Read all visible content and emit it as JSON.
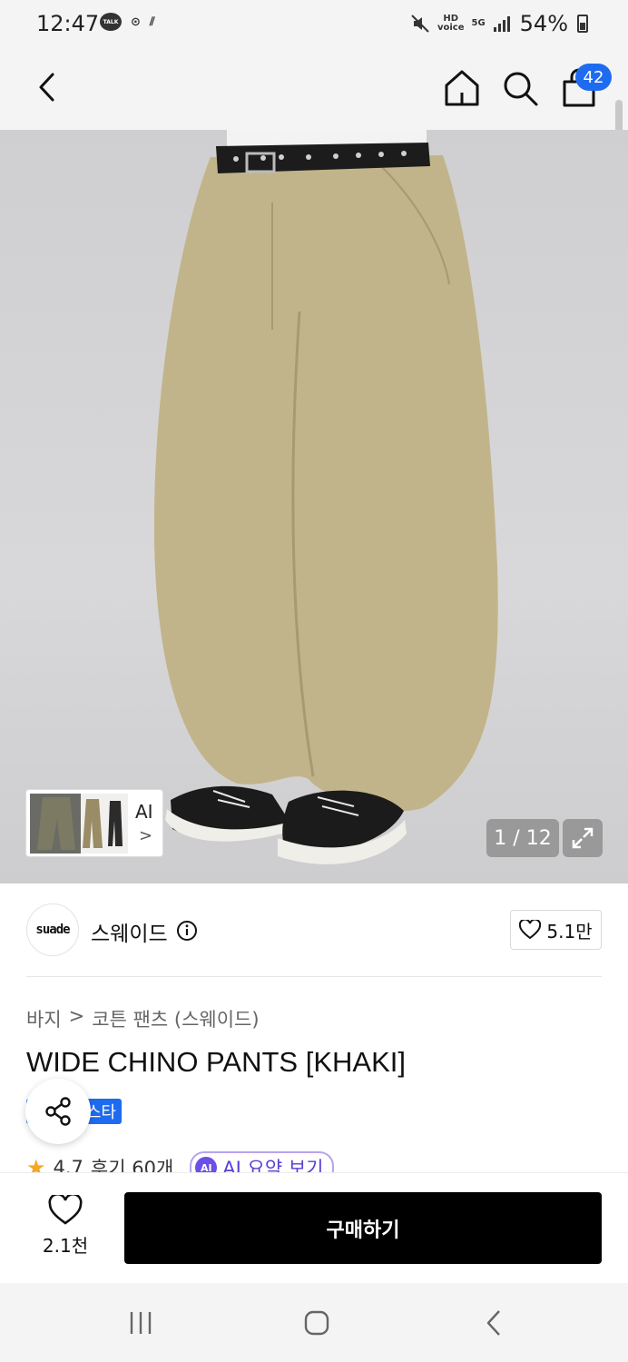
{
  "status_bar": {
    "time": "12:47",
    "talk_label": "TALK",
    "hd_label": "HD",
    "network": "5G",
    "battery": "54%"
  },
  "header": {
    "cart_count": "42"
  },
  "gallery": {
    "thumb_label": "AI",
    "page_counter": "1 / 12"
  },
  "brand": {
    "logo_text": "suade",
    "name": "스웨이드",
    "likes": "5.1만"
  },
  "breadcrumb": [
    "바지",
    "코튼 팬츠 (스웨이드)"
  ],
  "product": {
    "title": "WIDE CHINO PANTS [KHAKI]",
    "tag_visible": "스타",
    "rating": "4.7",
    "reviews": "후기 60개",
    "ai_summary": "AI 요약 보기"
  },
  "bottom_bar": {
    "wish_count": "2.1천",
    "buy_label": "구매하기"
  },
  "colors": {
    "accent": "#1f6bf0",
    "buy_button": "#000000",
    "star": "#f5a623",
    "ai_purple": "#6c4ee8",
    "pants": "#c2b48a"
  }
}
